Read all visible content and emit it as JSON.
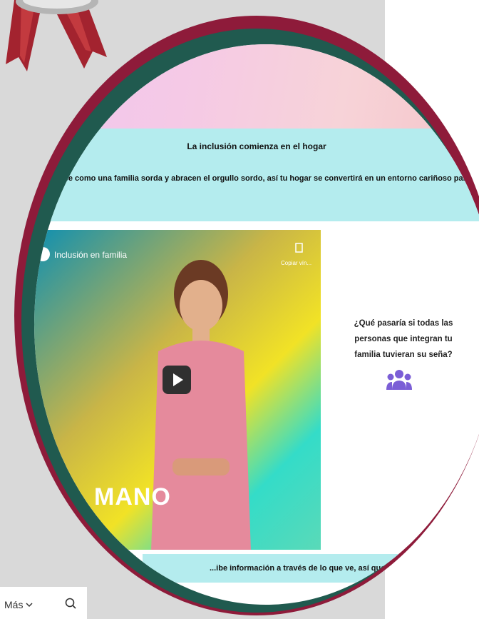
{
  "banner": {
    "title": "La inclusión comienza en el hogar",
    "subtitle": "Siéntanse como una familia sorda y abracen el orgullo sordo, así tu hogar se convertirá en un entorno cariñoso para tu bebé."
  },
  "video": {
    "title": "Inclusión en familia",
    "copy_label": "Copiar vín...",
    "overlay_word": "MANO",
    "play_icon": "play-icon",
    "copy_icon": "copy-icon"
  },
  "question": {
    "text": "¿Qué pasaría si todas las personas que integran tu familia tuvieran su seña?",
    "icon": "users-icon"
  },
  "footer_strip": {
    "text": "...ibe información a través de lo que ve, así que..."
  },
  "toolbar": {
    "more_label": "Más",
    "search_icon": "search-icon"
  },
  "colors": {
    "frame_red": "#8e1b3a",
    "frame_green": "#205a4f",
    "banner": "#b4ecee",
    "icon_purple": "#7b5ed6"
  }
}
